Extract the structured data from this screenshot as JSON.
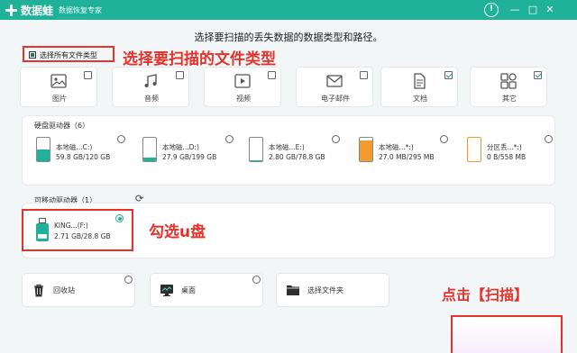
{
  "app": {
    "name": "数据蛙",
    "subtitle": "数据恢复专家"
  },
  "window_controls": {
    "help": "!",
    "minimize": "—",
    "maximize": "□",
    "close": "✕"
  },
  "heading": "选择要扫描的丢失数据的数据类型和路径。",
  "select_all": {
    "label": "选择所有文件类型",
    "checked": true
  },
  "file_types": [
    {
      "label": "图片",
      "icon": "image-icon",
      "checked": false
    },
    {
      "label": "音频",
      "icon": "music-icon",
      "checked": false
    },
    {
      "label": "视频",
      "icon": "video-icon",
      "checked": false
    },
    {
      "label": "电子邮件",
      "icon": "email-icon",
      "checked": false
    },
    {
      "label": "文档",
      "icon": "document-icon",
      "checked": true
    },
    {
      "label": "其它",
      "icon": "other-icon",
      "checked": true
    }
  ],
  "hard_drives": {
    "title": "硬盘驱动器（6）",
    "items": [
      {
        "name": "本地磁...C:)",
        "size": "59.8 GB/120 GB",
        "used_fraction": 0.5,
        "color": "#1fb19a",
        "selected": false
      },
      {
        "name": "本地磁...D:)",
        "size": "27.9 GB/199 GB",
        "used_fraction": 0.14,
        "color": "#1fb19a",
        "selected": false
      },
      {
        "name": "本地磁...E:)",
        "size": "2.80 GB/78.8 GB",
        "used_fraction": 0.04,
        "color": "#1fb19a",
        "selected": false
      },
      {
        "name": "本地磁...*:)",
        "size": "27.0 MB/295 MB",
        "used_fraction": 0.9,
        "color": "#f39a2c",
        "selected": false
      },
      {
        "name": "分区丢...*:)",
        "size": "0 B/558 MB",
        "used_fraction": 0.0,
        "color": "#f39a2c",
        "selected": false
      }
    ]
  },
  "removable": {
    "title": "可移动驱动器（1）",
    "refresh_icon": "refresh-icon",
    "items": [
      {
        "name": "KING...(F:)",
        "size": "2.71 GB/28.8 GB",
        "used_fraction": 0.09,
        "selected": true
      }
    ]
  },
  "locations": [
    {
      "label": "回收站",
      "icon": "recycle-bin-icon"
    },
    {
      "label": "桌面",
      "icon": "desktop-icon"
    },
    {
      "label": "选择文件夹",
      "icon": "folder-icon"
    }
  ],
  "annotations": {
    "select_types": "选择要扫描的文件类型",
    "check_usb": "勾选u盘",
    "click_scan": "点击【扫描】"
  },
  "colors": {
    "accent": "#1fb19a",
    "annotation": "#e5322d"
  }
}
